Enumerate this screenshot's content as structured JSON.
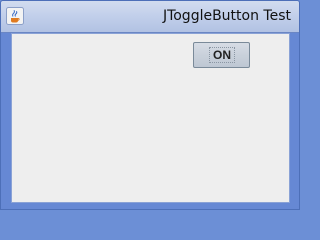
{
  "window": {
    "title": "JToggleButton Test",
    "icon": "java-cup-icon"
  },
  "toggle_button": {
    "label": "ON",
    "state": "selected"
  },
  "colors": {
    "frame": "#6688d4",
    "content_background": "#eeeeee",
    "button_face": "#c9d1db"
  }
}
